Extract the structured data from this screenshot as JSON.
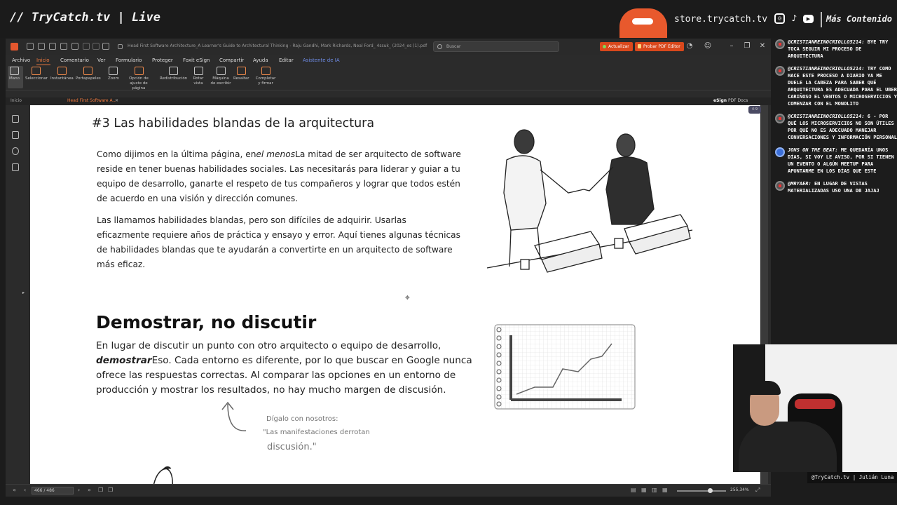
{
  "stream": {
    "title": "// TryCatch.tv | Live",
    "store_url": "store.trycatch.tv",
    "more_content": "Más Contenido",
    "icons": [
      "instagram-icon",
      "tiktok-icon",
      "youtube-icon"
    ]
  },
  "app": {
    "doc_title": "Head First Software Architecture_A Learner's Guide to Architectural Thinking - Raju Gandhi, Mark Richards, Neal Ford_ 4ssuk_ (2024_es (1).pdf",
    "search_placeholder": "Buscar",
    "update_button": "Actualizar",
    "try_editor_button": "Probar PDF Editor",
    "menu": [
      "Archivo",
      "Inicio",
      "Comentario",
      "Ver",
      "Formulario",
      "Proteger",
      "Foxit eSign",
      "Compartir",
      "Ayuda",
      "Editar",
      "Asistente de IA"
    ],
    "ribbon": [
      {
        "label": "Mano"
      },
      {
        "label": "Seleccionar"
      },
      {
        "label": "Instantánea"
      },
      {
        "label": "Portapapeles"
      },
      {
        "label": "Zoom"
      },
      {
        "label": "Opción de ajuste de página"
      },
      {
        "label": "Redistribución"
      },
      {
        "label": "Rotar vista"
      },
      {
        "label": "Máquina de escribir"
      },
      {
        "label": "Resaltar"
      },
      {
        "label": "Completar y firmar"
      }
    ],
    "tabs": [
      "Inicio",
      "Head First Software A..."
    ],
    "esign_label": "eSign",
    "esign_suffix": "PDF Docs",
    "page_indicator": "466 / 486",
    "zoom_value": "255,34%",
    "float_badge": "4-9"
  },
  "document": {
    "heading": "#3 Las habilidades blandas de la arquitectura",
    "p1_pre": "Como dijimos en la última página, en",
    "p1_italic": "el menos",
    "p1_post": "La mitad de ser arquitecto de software reside en tener buenas habilidades sociales. Las necesitarás para liderar y guiar a tu equipo de desarrollo, ganarte el respeto de tus compañeros y lograr que todos estén de acuerdo en una visión y dirección comunes.",
    "p2": "Las llamamos habilidades blandas, pero son difíciles de adquirir. Usarlas eficazmente requiere años de práctica y ensayo y error. Aquí tienes algunas técnicas de habilidades blandas que te ayudarán a convertirte en un arquitecto de software más eficaz.",
    "section_title": "Demostrar, no discutir",
    "p3_pre": "En lugar de discutir un punto con otro arquitecto o equipo de desarrollo,",
    "p3_bold": "demostrar",
    "p3_post": "Eso. Cada entorno es diferente, por lo que buscar en Google nunca ofrece las respuestas correctas. Al comparar las opciones en un entorno de producción y mostrar los resultados, no hay mucho margen de discusión.",
    "note_1": "Dígalo con nosotros:",
    "note_2": "\"Las manifestaciones derrotan",
    "note_3": "discusión.\""
  },
  "chat": [
    {
      "user": "@cristianreinocriollo5214:",
      "text": "bye try toca seguir mi proceso de arquitectura",
      "platform": "youtube"
    },
    {
      "user": "@cristianreinocriollo5214:",
      "text": "try como hace este proceso a diario ya me duele la cabeza para saber qué arquitectura es adecuada para el uber cariñoso el ventos o microservicios y comenzar con el monolito",
      "platform": "youtube"
    },
    {
      "user": "@cristianreinocriollo5214:",
      "text": "6 - por qué los microservicios no son útiles por qué no es adecuado manejar conversaciones y información personal",
      "platform": "youtube"
    },
    {
      "user": "Jons on the beat:",
      "text": "me quedaría unos días, si voy le aviso, por si tienen un evento o algún meetup para apuntarme en los días que este",
      "platform": "facebook"
    },
    {
      "user": "@mryaer:",
      "text": "en lugar de vistas materializadas uso una db jajaj",
      "platform": "youtube"
    }
  ],
  "webcam": {
    "caption": "@TryCatch.tv | Julián Luna"
  }
}
